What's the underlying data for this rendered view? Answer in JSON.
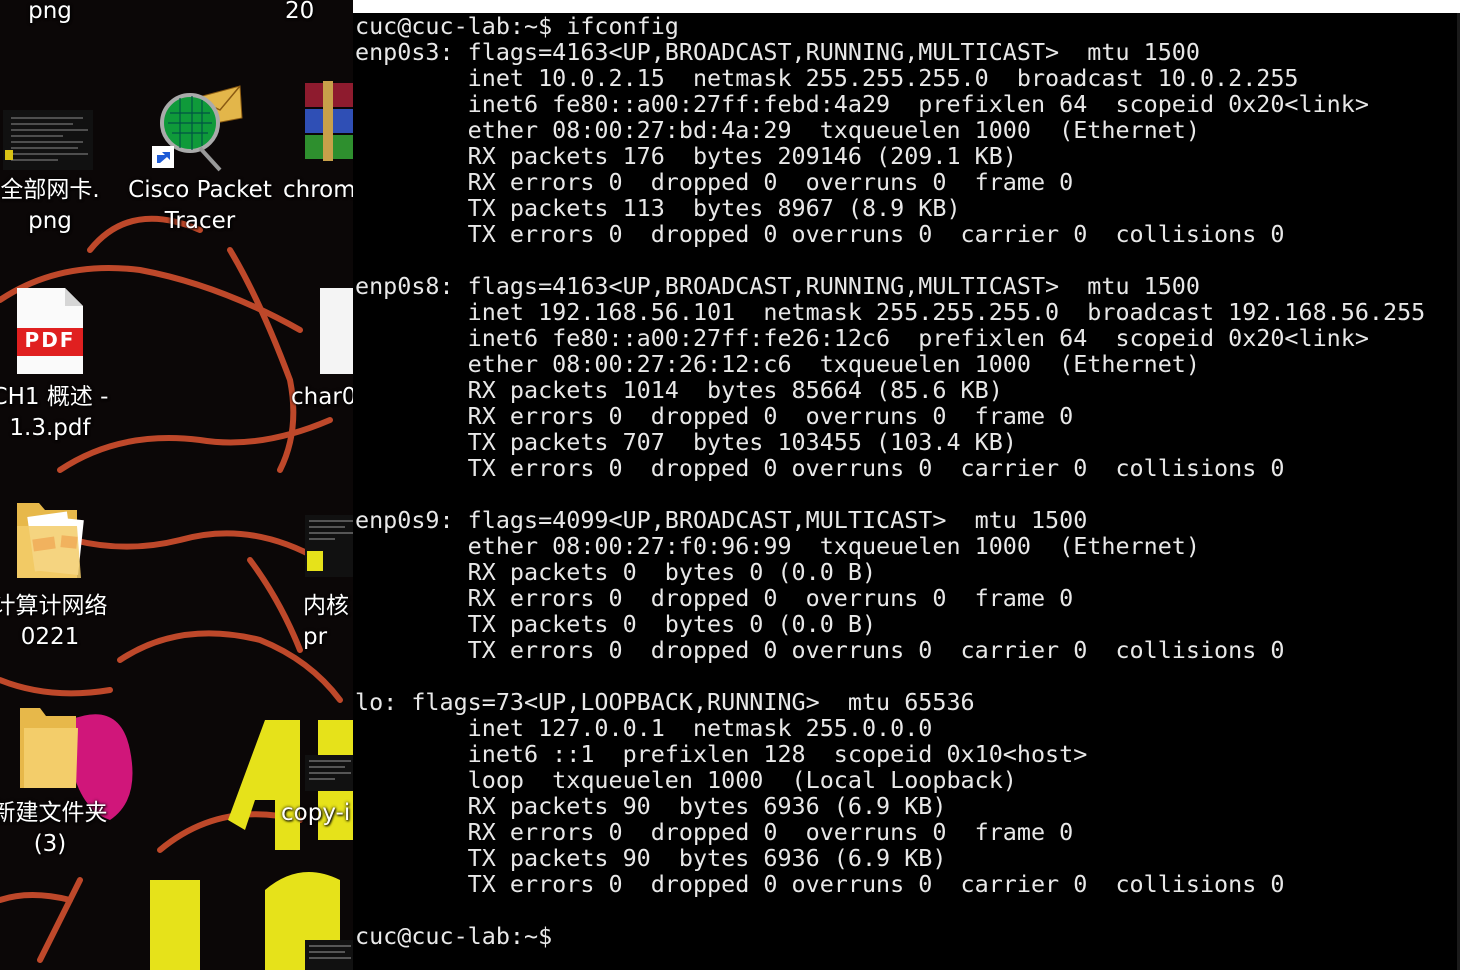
{
  "desktop": {
    "icons": [
      {
        "id": "png-top",
        "label": "png"
      },
      {
        "id": "top-right-number",
        "label": "20"
      },
      {
        "id": "all-nics-png",
        "label": "全部网卡.\npng"
      },
      {
        "id": "cisco-packet-tracer",
        "label": "Cisco Packet\nTracer"
      },
      {
        "id": "chrome",
        "label": "chrom"
      },
      {
        "id": "ch1-pdf",
        "label": "CH1 概述 -\n1.3.pdf"
      },
      {
        "id": "char0",
        "label": "char0"
      },
      {
        "id": "cn-folder",
        "label": "计算计网络\n0221"
      },
      {
        "id": "kernel-item",
        "label": "内核\npr"
      },
      {
        "id": "new-folder-3",
        "label": "新建文件夹\n(3)"
      },
      {
        "id": "copy-item",
        "label": "copy-i"
      }
    ],
    "pdf_badge": "PDF",
    "pdf_folder_badge": "PDF"
  },
  "terminal": {
    "output": "cuc@cuc-lab:~$ ifconfig\nenp0s3: flags=4163<UP,BROADCAST,RUNNING,MULTICAST>  mtu 1500\n        inet 10.0.2.15  netmask 255.255.255.0  broadcast 10.0.2.255\n        inet6 fe80::a00:27ff:febd:4a29  prefixlen 64  scopeid 0x20<link>\n        ether 08:00:27:bd:4a:29  txqueuelen 1000  (Ethernet)\n        RX packets 176  bytes 209146 (209.1 KB)\n        RX errors 0  dropped 0  overruns 0  frame 0\n        TX packets 113  bytes 8967 (8.9 KB)\n        TX errors 0  dropped 0 overruns 0  carrier 0  collisions 0\n\nenp0s8: flags=4163<UP,BROADCAST,RUNNING,MULTICAST>  mtu 1500\n        inet 192.168.56.101  netmask 255.255.255.0  broadcast 192.168.56.255\n        inet6 fe80::a00:27ff:fe26:12c6  prefixlen 64  scopeid 0x20<link>\n        ether 08:00:27:26:12:c6  txqueuelen 1000  (Ethernet)\n        RX packets 1014  bytes 85664 (85.6 KB)\n        RX errors 0  dropped 0  overruns 0  frame 0\n        TX packets 707  bytes 103455 (103.4 KB)\n        TX errors 0  dropped 0 overruns 0  carrier 0  collisions 0\n\nenp0s9: flags=4099<UP,BROADCAST,MULTICAST>  mtu 1500\n        ether 08:00:27:f0:96:99  txqueuelen 1000  (Ethernet)\n        RX packets 0  bytes 0 (0.0 B)\n        RX errors 0  dropped 0  overruns 0  frame 0\n        TX packets 0  bytes 0 (0.0 B)\n        TX errors 0  dropped 0 overruns 0  carrier 0  collisions 0\n\nlo: flags=73<UP,LOOPBACK,RUNNING>  mtu 65536\n        inet 127.0.0.1  netmask 255.0.0.0\n        inet6 ::1  prefixlen 128  scopeid 0x10<host>\n        loop  txqueuelen 1000  (Local Loopback)\n        RX packets 90  bytes 6936 (6.9 KB)\n        RX errors 0  dropped 0  overruns 0  frame 0\n        TX packets 90  bytes 6936 (6.9 KB)\n        TX errors 0  dropped 0 overruns 0  carrier 0  collisions 0",
    "prompt": "cuc@cuc-lab:~$ ",
    "bg_color": "#000000",
    "fg_color": "#e8e8e8"
  }
}
